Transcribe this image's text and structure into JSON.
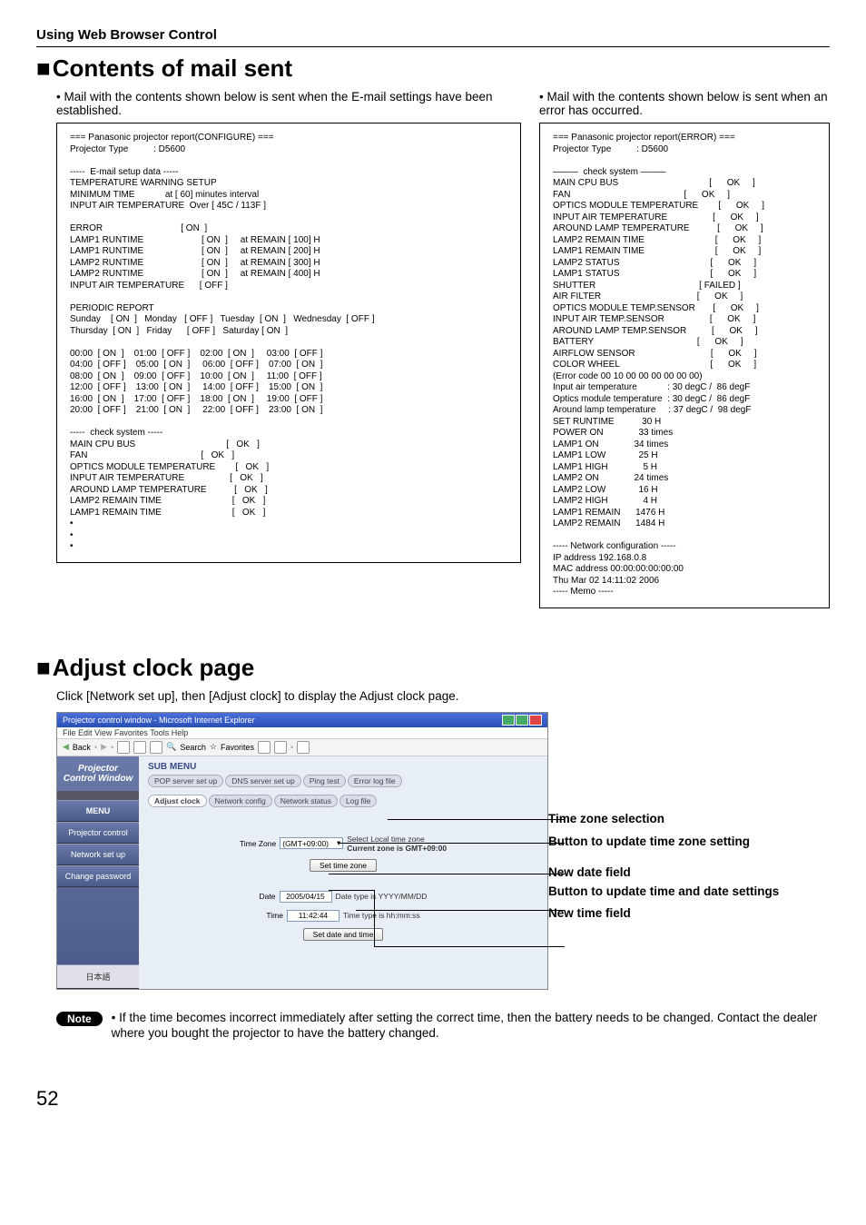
{
  "section_title": "Using Web Browser Control",
  "heading1": "Contents of mail sent",
  "intro_left": "• Mail with the contents shown below is sent when the E-mail settings have been established.",
  "intro_right": "• Mail with the contents shown below is sent when an error has occurred.",
  "report_left": "=== Panasonic projector report(CONFIGURE) ===\nProjector Type          : D5600\n\n-----  E-mail setup data -----\nTEMPERATURE WARNING SETUP \nMINIMUM TIME            at [ 60] minutes interval \nINPUT AIR TEMPERATURE  Over [ 45C / 113F ] \n\nERROR                               [ ON  ]\nLAMP1 RUNTIME                       [ ON  ]     at REMAIN [ 100] H \nLAMP1 RUNTIME                       [ ON  ]     at REMAIN [ 200] H \nLAMP2 RUNTIME                       [ ON  ]     at REMAIN [ 300] H \nLAMP2 RUNTIME                       [ ON  ]     at REMAIN [ 400] H \nINPUT AIR TEMPERATURE      [ OFF ] \n\nPERIODIC REPORT \nSunday    [ ON  ]   Monday   [ OFF ]   Tuesday  [ ON  ]   Wednesday  [ OFF ]\nThursday  [ ON  ]   Friday      [ OFF ]   Saturday [ ON  ] \n\n00:00  [ ON  ]    01:00  [ OFF ]    02:00  [ ON  ]     03:00  [ OFF ] \n04:00  [ OFF ]    05:00  [ ON  ]     06:00  [ OFF ]    07:00  [ ON  ] \n08:00  [ ON  ]    09:00  [ OFF ]    10:00  [ ON  ]     11:00  [ OFF ] \n12:00  [ OFF ]    13:00  [ ON  ]     14:00  [ OFF ]    15:00  [ ON  ] \n16:00  [ ON  ]    17:00  [ OFF ]    18:00  [ ON  ]     19:00  [ OFF ] \n20:00  [ OFF ]    21:00  [ ON  ]     22:00  [ OFF ]    23:00  [ ON  ] \n\n-----  check system -----\nMAIN CPU BUS                                    [   OK   ]\nFAN                                             [   OK   ]\nOPTICS MODULE TEMPERATURE        [   OK   ]\nINPUT AIR TEMPERATURE                  [   OK   ]\nAROUND LAMP TEMPERATURE           [   OK   ]\nLAMP2 REMAIN TIME                            [   OK   ]\nLAMP1 REMAIN TIME                            [   OK   ]\n•\n•\n•",
  "report_right": "=== Panasonic projector report(ERROR) ===\nProjector Type          : D5600\n\n–––––  check system –––––\nMAIN CPU BUS                                    [      OK     ]\nFAN                                             [      OK     ]\nOPTICS MODULE TEMPERATURE        [      OK     ]\nINPUT AIR TEMPERATURE                  [      OK     ]\nAROUND LAMP TEMPERATURE           [      OK     ]\nLAMP2 REMAIN TIME                            [      OK     ]\nLAMP1 REMAIN TIME                            [      OK     ]\nLAMP2 STATUS                                    [      OK     ]\nLAMP1 STATUS                                    [      OK     ]\nSHUTTER                                         [ FAILED ]\nAIR FILTER                                      [      OK     ]\nOPTICS MODULE TEMP.SENSOR       [      OK     ]\nINPUT AIR TEMP.SENSOR                  [      OK     ]\nAROUND LAMP TEMP.SENSOR          [      OK     ]\nBATTERY                                         [      OK     ]\nAIRFLOW SENSOR                              [      OK     ]\nCOLOR WHEEL                                    [      OK     ]\n(Error code 00 10 00 00 00 00 00 00)\nInput air temperature            : 30 degC /  86 degF\nOptics module temperature  : 30 degC /  86 degF\nAround lamp temperature     : 37 degC /  98 degF\nSET RUNTIME           30 H\nPOWER ON              33 times\nLAMP1 ON              34 times\nLAMP1 LOW             25 H\nLAMP1 HIGH              5 H\nLAMP2 ON              24 times\nLAMP2 LOW             16 H\nLAMP2 HIGH              4 H\nLAMP1 REMAIN      1476 H\nLAMP2 REMAIN      1484 H\n\n----- Network configuration -----\nIP address 192.168.0.8\nMAC address 00:00:00:00:00:00\nThu Mar 02 14:11:02 2006\n----- Memo -----",
  "heading2": "Adjust clock page",
  "adjust_intro": "Click [Network set up], then [Adjust clock] to display the Adjust clock page.",
  "ss": {
    "title": "Projector control window - Microsoft Internet Explorer",
    "menubar": "File   Edit   View   Favorites   Tools   Help",
    "back": "Back",
    "search": "Search",
    "favorites": "Favorites",
    "side_header": "Projector Control Window",
    "menu": "MENU",
    "pc": "Projector control",
    "ns": "Network set up",
    "cp": "Change password",
    "jp": "日本語",
    "submenu": "SUB MENU",
    "tabs": {
      "pop": "POP server set up",
      "dns": "DNS server set up",
      "ping": "Ping test",
      "err": "Error log file",
      "clock": "Adjust clock",
      "net": "Network config",
      "status": "Network status",
      "log": "Log file"
    },
    "tz_label": "Time Zone",
    "tz_value": "(GMT+09:00)",
    "tz_caption_a": "Select Local time zone",
    "tz_caption_b": "Current zone is GMT+09:00",
    "btn_tz": "Set time zone",
    "date_label": "Date",
    "date_value": "2005/04/15",
    "date_caption": "Date type is YYYY/MM/DD",
    "time_label": "Time",
    "time_value": "11:42:44",
    "time_caption": "Time type is hh:mm:ss",
    "btn_dt": "Set date and time"
  },
  "annot": {
    "a1": "Time zone selection",
    "a2": "Button to update time zone setting",
    "a3": "New date field",
    "a4": "Button to update time and date settings",
    "a5": "New time field"
  },
  "note_label": "Note",
  "note_text": "• If the time becomes incorrect immediately after setting the correct time, then the battery needs to be changed. Contact the dealer where you bought the projector to have the battery changed.",
  "page_number": "52"
}
